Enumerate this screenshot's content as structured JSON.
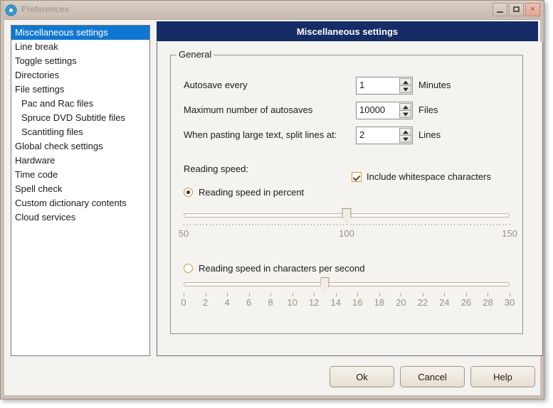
{
  "window": {
    "title": "Preferences",
    "icon": "gear-icon",
    "minimize_label": "Minimize",
    "maximize_label": "Maximize",
    "close_label": "Close",
    "close_glyph": "×"
  },
  "sidebar": {
    "items": [
      {
        "label": "Miscellaneous settings",
        "selected": true,
        "indent": false
      },
      {
        "label": "Line break",
        "selected": false,
        "indent": false
      },
      {
        "label": "Toggle settings",
        "selected": false,
        "indent": false
      },
      {
        "label": "Directories",
        "selected": false,
        "indent": false
      },
      {
        "label": "File settings",
        "selected": false,
        "indent": false
      },
      {
        "label": "Pac and Rac files",
        "selected": false,
        "indent": true
      },
      {
        "label": "Spruce DVD Subtitle files",
        "selected": false,
        "indent": true
      },
      {
        "label": "Scantitling files",
        "selected": false,
        "indent": true
      },
      {
        "label": "Global check settings",
        "selected": false,
        "indent": false
      },
      {
        "label": "Hardware",
        "selected": false,
        "indent": false
      },
      {
        "label": "Time code",
        "selected": false,
        "indent": false
      },
      {
        "label": "Spell check",
        "selected": false,
        "indent": false
      },
      {
        "label": "Custom dictionary contents",
        "selected": false,
        "indent": false
      },
      {
        "label": "Cloud services",
        "selected": false,
        "indent": false
      }
    ]
  },
  "panel": {
    "header_title": "Miscellaneous settings",
    "group": {
      "legend": "General",
      "rows": [
        {
          "label": "Autosave every",
          "value": "1",
          "unit": "Minutes"
        },
        {
          "label": "Maximum number of autosaves",
          "value": "10000",
          "unit": "Files"
        },
        {
          "label": "When pasting large text, split lines at:",
          "value": "2",
          "unit": "Lines"
        }
      ],
      "reading_speed_label": "Reading speed:",
      "whitespace_checkbox": {
        "label": "Include whitespace characters",
        "checked": true
      },
      "radio_percent": {
        "label": "Reading speed in percent",
        "checked": true
      },
      "radio_cps": {
        "label": "Reading speed in characters per second",
        "checked": false
      },
      "slider_percent": {
        "min": 50,
        "max": 150,
        "value": 100,
        "tick_labels": [
          "50",
          "100",
          "150"
        ],
        "tick_values": [
          50,
          100,
          150
        ]
      },
      "slider_cps": {
        "min": 0,
        "max": 30,
        "value": 13,
        "tick_labels": [
          "0",
          "2",
          "4",
          "6",
          "8",
          "10",
          "12",
          "14",
          "16",
          "18",
          "20",
          "22",
          "24",
          "26",
          "28",
          "30"
        ],
        "tick_values": [
          0,
          2,
          4,
          6,
          8,
          10,
          12,
          14,
          16,
          18,
          20,
          22,
          24,
          26,
          28,
          30
        ]
      }
    }
  },
  "footer": {
    "ok_label": "Ok",
    "cancel_label": "Cancel",
    "help_label": "Help"
  },
  "colors": {
    "header_navy": "#152c66",
    "selection_blue": "#1077d1",
    "accent_orange": "#d09a45",
    "window_chrome": "#cbbfb5"
  }
}
